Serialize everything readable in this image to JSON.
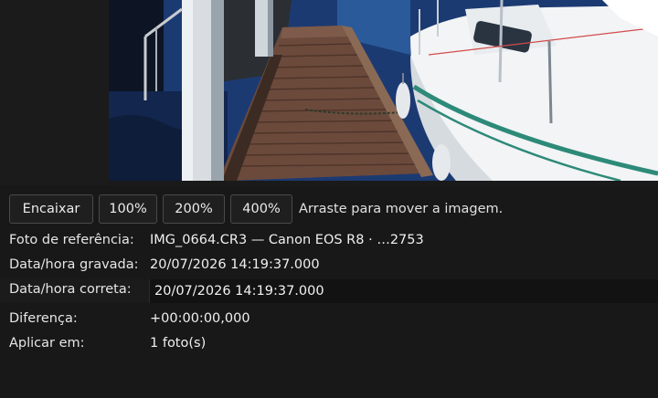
{
  "zoom_buttons": {
    "fit": "Encaixar",
    "z100": "100%",
    "z200": "200%",
    "z400": "400%"
  },
  "drag_hint": "Arraste para mover a imagem.",
  "reference_photo": {
    "label": "Foto de referência:",
    "value": "IMG_0664.CR3 — Canon EOS R8 · …2753"
  },
  "recorded_datetime": {
    "label": "Data/hora gravada:",
    "value": "20/07/2026 14:19:37.000"
  },
  "correct_datetime": {
    "label": "Data/hora correta:",
    "value": "20/07/2026 14:19:37.000"
  },
  "difference": {
    "label": "Diferença:",
    "value": "+00:00:00,000"
  },
  "apply_to": {
    "label": "Aplicar em:",
    "value": "1 foto(s)"
  }
}
